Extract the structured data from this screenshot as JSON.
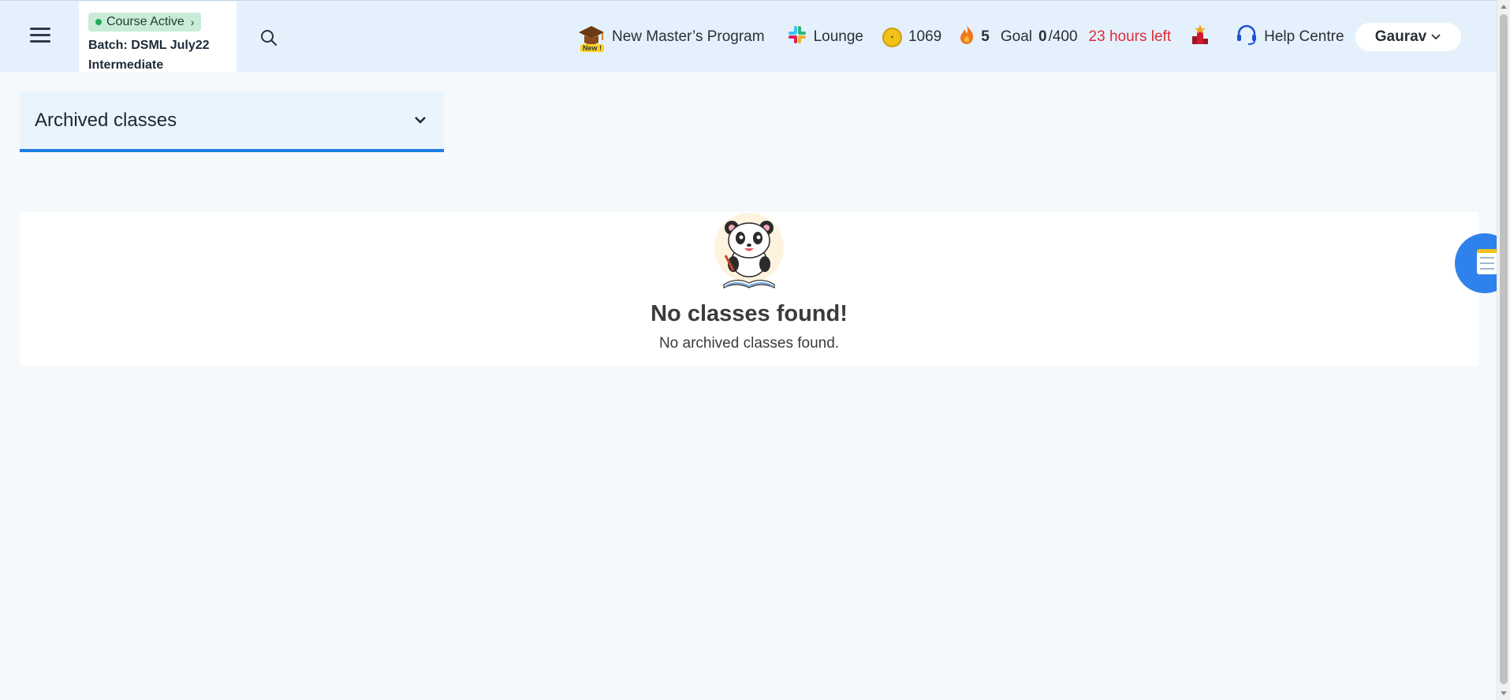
{
  "header": {
    "course_status": "Course Active",
    "batch_line1": "Batch: DSML July22",
    "batch_line2": "Intermediate",
    "masters_badge": "New !",
    "masters_label": "New Master’s Program",
    "lounge_label": "Lounge",
    "coins": "1069",
    "streak": "5",
    "goal_prefix": "Goal",
    "goal_done": "0",
    "goal_total": "/400",
    "time_left": "23 hours left",
    "help_label": "Help Centre",
    "user_name": "Gaurav"
  },
  "main": {
    "dropdown_label": "Archived classes",
    "empty_title": "No classes found!",
    "empty_subtitle": "No archived classes found."
  },
  "colors": {
    "header_bg": "#e4f1fc",
    "accent_blue": "#1a7fe3",
    "status_green": "#1fae57",
    "time_red": "#e02b3b"
  }
}
